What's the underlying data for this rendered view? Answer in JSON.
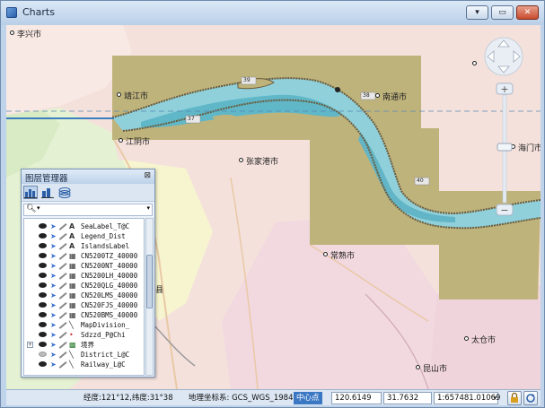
{
  "window": {
    "title": "Charts"
  },
  "map": {
    "labels": [
      {
        "text": "李兴市"
      },
      {
        "text": "靖江市"
      },
      {
        "text": "江阴市"
      },
      {
        "text": "张家港市"
      },
      {
        "text": "南通市"
      },
      {
        "text": "常熟市"
      },
      {
        "text": "昆山市"
      },
      {
        "text": "太仓市"
      },
      {
        "text": "海门市"
      },
      {
        "text": "县"
      }
    ],
    "badges": [
      "37",
      "38",
      "39",
      "40"
    ]
  },
  "layer_panel": {
    "title": "图层管理器",
    "layers": [
      {
        "name": "SeaLabel_T@C",
        "type": "A"
      },
      {
        "name": "Legend_Dist",
        "type": "A"
      },
      {
        "name": "IslandsLabel",
        "type": "A"
      },
      {
        "name": "CN5200TZ_40000",
        "type": "img"
      },
      {
        "name": "CN5200NT_40000",
        "type": "img"
      },
      {
        "name": "CN5200LH_40000",
        "type": "img"
      },
      {
        "name": "CN520QLG_40000",
        "type": "img"
      },
      {
        "name": "CN520LMS_40000",
        "type": "img"
      },
      {
        "name": "CN520FJS_40000",
        "type": "img"
      },
      {
        "name": "CN520BMS_40000",
        "type": "img"
      },
      {
        "name": "MapDivision_",
        "type": "line"
      },
      {
        "name": "Sdzzd_P@Chi",
        "type": "point"
      },
      {
        "name": "境界",
        "type": "group"
      },
      {
        "name": "District_L@C",
        "type": "line"
      },
      {
        "name": "Railway_L@C",
        "type": "line"
      }
    ]
  },
  "status": {
    "coords_text": "经度:121°12,纬度:31°38",
    "crs_text": "地理坐标系: GCS_WGS_1984",
    "center_label": "中心点",
    "center_x": "120.6149",
    "center_y": "31.7632",
    "scale": "1:657481.01069"
  }
}
